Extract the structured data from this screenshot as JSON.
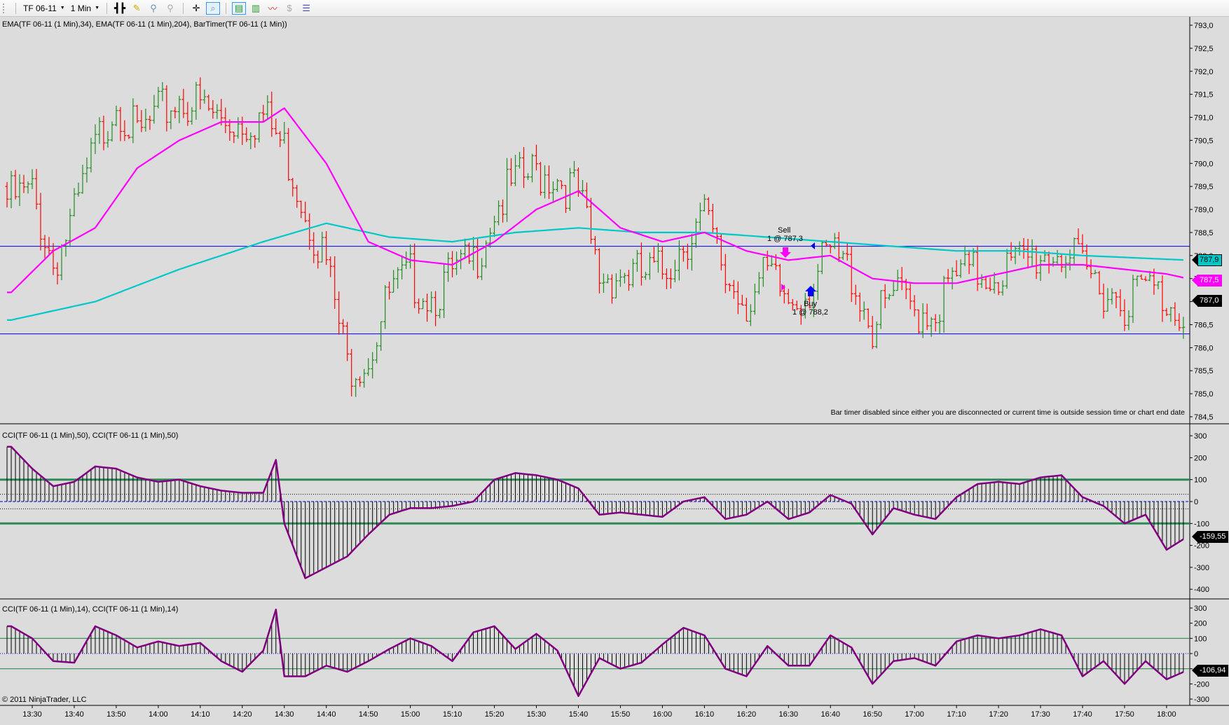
{
  "toolbar": {
    "instrument": "TF 06-11",
    "interval": "1 Min",
    "icons": [
      "bar-type-icon",
      "drawing-pencil-icon",
      "zoom-in-icon",
      "zoom-out-icon",
      "crosshair-icon",
      "magnifier-icon",
      "chart-trader-icon",
      "candlestick-icon",
      "indicator-icon",
      "dollar-icon",
      "properties-icon"
    ]
  },
  "panes": {
    "price_title": "EMA(TF 06-11 (1 Min),34), EMA(TF 06-11 (1 Min),204), BarTimer(TF 06-11 (1 Min))",
    "cci50_title": "CCI(TF 06-11 (1 Min),50), CCI(TF 06-11 (1 Min),50)",
    "cci14_title": "CCI(TF 06-11 (1 Min),14), CCI(TF 06-11 (1 Min),14)",
    "bar_timer_message": "Bar timer disabled since either you are disconnected or current time is outside session time or chart end date",
    "copyright": "© 2011 NinjaTrader, LLC"
  },
  "orders": {
    "sell_label": "Sell",
    "sell_detail": "1 @ 787,3",
    "buy_label": "Buy",
    "buy_detail": "1 @ 788,2"
  },
  "axis_tags": {
    "ema204": "787,9",
    "ema34": "787,5",
    "last_price": "787,0",
    "cci50": "-159,55",
    "cci14": "-106,94"
  },
  "colors": {
    "up_bar": "#228b22",
    "down_bar": "#ff0000",
    "ema34": "#ff00ff",
    "ema204": "#00c8c8",
    "cci_line": "#800080",
    "level_line": "#2e8b57",
    "horizontal_line": "#0000ff"
  },
  "time_axis": [
    "13:30",
    "13:40",
    "13:50",
    "14:00",
    "14:10",
    "14:20",
    "14:30",
    "14:40",
    "14:50",
    "15:00",
    "15:10",
    "15:20",
    "15:30",
    "15:40",
    "15:50",
    "16:00",
    "16:10",
    "16:20",
    "16:30",
    "16:40",
    "16:50",
    "17:00",
    "17:10",
    "17:20",
    "17:30",
    "17:40",
    "17:50",
    "18:00"
  ],
  "chart_data": [
    {
      "type": "ohlc",
      "name": "TF 06-11 (1 Min)",
      "y_ticks": [
        "793,0",
        "792,5",
        "792,0",
        "791,5",
        "791,0",
        "790,5",
        "790,0",
        "789,5",
        "789,0",
        "788,5",
        "788,0",
        "787,5",
        "787,0",
        "786,5",
        "786,0",
        "785,5",
        "785,0",
        "784,5"
      ],
      "ylim": [
        784.5,
        793.0
      ],
      "horizontal_lines": [
        788.2,
        786.3
      ],
      "close_5min": {
        "times": [
          "13:25",
          "13:30",
          "13:35",
          "13:40",
          "13:45",
          "13:50",
          "13:55",
          "14:00",
          "14:05",
          "14:10",
          "14:15",
          "14:20",
          "14:25",
          "14:30",
          "14:35",
          "14:40",
          "14:45",
          "14:50",
          "14:55",
          "15:00",
          "15:05",
          "15:10",
          "15:15",
          "15:20",
          "15:25",
          "15:30",
          "15:35",
          "15:40",
          "15:45",
          "15:50",
          "15:55",
          "16:00",
          "16:05",
          "16:10",
          "16:15",
          "16:20",
          "16:25",
          "16:30",
          "16:35",
          "16:40",
          "16:45",
          "16:50",
          "16:55",
          "17:00",
          "17:05",
          "17:10",
          "17:15",
          "17:20",
          "17:25",
          "17:30",
          "17:35",
          "17:40",
          "17:45",
          "17:50",
          "17:55",
          "18:00",
          "18:05"
        ],
        "values": [
          789.5,
          789.6,
          788.1,
          789.1,
          790.6,
          791.7,
          790.8,
          791.3,
          791.7,
          791.5,
          791.2,
          791.2,
          791.3,
          790.6,
          789.3,
          788.1,
          785.9,
          786.1,
          787.4,
          787.8,
          787.4,
          787.8,
          788.1,
          789.3,
          789.8,
          790.1,
          790.0,
          789.6,
          787.8,
          787.9,
          787.8,
          787.9,
          788.6,
          789.1,
          787.8,
          787.3,
          787.8,
          787.3,
          787.6,
          788.3,
          787.9,
          786.7,
          787.4,
          787.1,
          787.1,
          787.8,
          787.9,
          787.9,
          788.1,
          788.3,
          788.4,
          787.9,
          787.6,
          787.3,
          787.6,
          787.3,
          787.0
        ]
      },
      "ema34": {
        "times": [
          "13:25",
          "13:35",
          "13:45",
          "13:55",
          "14:05",
          "14:15",
          "14:25",
          "14:30",
          "14:40",
          "14:50",
          "15:00",
          "15:10",
          "15:20",
          "15:30",
          "15:40",
          "15:50",
          "16:00",
          "16:10",
          "16:20",
          "16:30",
          "16:40",
          "16:50",
          "17:00",
          "17:10",
          "17:20",
          "17:30",
          "17:40",
          "17:50",
          "18:00",
          "18:05"
        ],
        "values": [
          787.2,
          788.1,
          788.6,
          789.9,
          790.5,
          790.9,
          790.9,
          791.2,
          790.0,
          788.3,
          787.9,
          787.8,
          788.3,
          789.0,
          789.4,
          788.6,
          788.3,
          788.5,
          788.1,
          787.9,
          788.0,
          787.5,
          787.4,
          787.4,
          787.6,
          787.8,
          787.8,
          787.7,
          787.6,
          787.5
        ]
      },
      "ema204": {
        "times": [
          "13:25",
          "13:45",
          "14:05",
          "14:25",
          "14:40",
          "14:55",
          "15:10",
          "15:25",
          "15:40",
          "15:55",
          "16:10",
          "16:25",
          "16:40",
          "16:55",
          "17:10",
          "17:25",
          "17:40",
          "18:05"
        ],
        "values": [
          786.6,
          787.0,
          787.7,
          788.3,
          788.7,
          788.4,
          788.3,
          788.5,
          788.6,
          788.5,
          788.5,
          788.4,
          788.3,
          788.2,
          788.1,
          788.1,
          788.0,
          787.9
        ]
      }
    },
    {
      "type": "line+histogram",
      "name": "CCI 50",
      "y_ticks": [
        "300",
        "200",
        "100",
        "0",
        "-100",
        "-200",
        "-300",
        "-400"
      ],
      "ylim": [
        -430,
        330
      ],
      "levels": [
        100,
        -100
      ],
      "times": [
        "13:25",
        "13:30",
        "13:35",
        "13:40",
        "13:45",
        "13:50",
        "13:55",
        "14:00",
        "14:05",
        "14:10",
        "14:15",
        "14:20",
        "14:25",
        "14:28",
        "14:30",
        "14:35",
        "14:40",
        "14:45",
        "14:50",
        "14:55",
        "15:00",
        "15:05",
        "15:10",
        "15:15",
        "15:20",
        "15:25",
        "15:30",
        "15:35",
        "15:40",
        "15:45",
        "15:50",
        "15:55",
        "16:00",
        "16:05",
        "16:10",
        "16:15",
        "16:20",
        "16:25",
        "16:30",
        "16:35",
        "16:40",
        "16:45",
        "16:50",
        "16:55",
        "17:00",
        "17:05",
        "17:10",
        "17:15",
        "17:20",
        "17:25",
        "17:30",
        "17:35",
        "17:40",
        "17:45",
        "17:50",
        "17:55",
        "18:00",
        "18:05"
      ],
      "values": [
        250,
        150,
        70,
        90,
        160,
        150,
        110,
        90,
        100,
        70,
        50,
        40,
        40,
        190,
        -100,
        -350,
        -300,
        -250,
        -150,
        -60,
        -30,
        -30,
        -20,
        0,
        100,
        130,
        120,
        100,
        60,
        -60,
        -50,
        -60,
        -70,
        0,
        20,
        -80,
        -60,
        0,
        -80,
        -50,
        30,
        -10,
        -150,
        -30,
        -60,
        -80,
        20,
        80,
        90,
        80,
        110,
        120,
        20,
        -20,
        -100,
        -60,
        -220,
        -160
      ]
    },
    {
      "type": "line+histogram",
      "name": "CCI 14",
      "y_ticks": [
        "300",
        "200",
        "100",
        "0",
        "-100",
        "-200",
        "-300"
      ],
      "ylim": [
        -340,
        330
      ],
      "levels": [
        100,
        -100
      ],
      "times": [
        "13:25",
        "13:30",
        "13:35",
        "13:40",
        "13:45",
        "13:50",
        "13:55",
        "14:00",
        "14:05",
        "14:10",
        "14:15",
        "14:20",
        "14:25",
        "14:28",
        "14:30",
        "14:35",
        "14:40",
        "14:45",
        "14:50",
        "14:55",
        "15:00",
        "15:05",
        "15:10",
        "15:15",
        "15:20",
        "15:25",
        "15:30",
        "15:35",
        "15:40",
        "15:45",
        "15:50",
        "15:55",
        "16:00",
        "16:05",
        "16:10",
        "16:15",
        "16:20",
        "16:25",
        "16:30",
        "16:35",
        "16:40",
        "16:45",
        "16:50",
        "16:55",
        "17:00",
        "17:05",
        "17:10",
        "17:15",
        "17:20",
        "17:25",
        "17:30",
        "17:35",
        "17:40",
        "17:45",
        "17:50",
        "17:55",
        "18:00",
        "18:05"
      ],
      "values": [
        180,
        100,
        -50,
        -60,
        180,
        120,
        40,
        80,
        50,
        70,
        -50,
        -120,
        20,
        290,
        -150,
        -150,
        -80,
        -120,
        -50,
        30,
        100,
        50,
        -50,
        140,
        180,
        30,
        130,
        20,
        -280,
        -30,
        -100,
        -60,
        60,
        170,
        120,
        -100,
        -150,
        50,
        -80,
        -80,
        120,
        40,
        -200,
        -50,
        -30,
        -80,
        80,
        120,
        100,
        120,
        160,
        120,
        -150,
        -50,
        -200,
        -50,
        -170,
        -110
      ]
    }
  ]
}
